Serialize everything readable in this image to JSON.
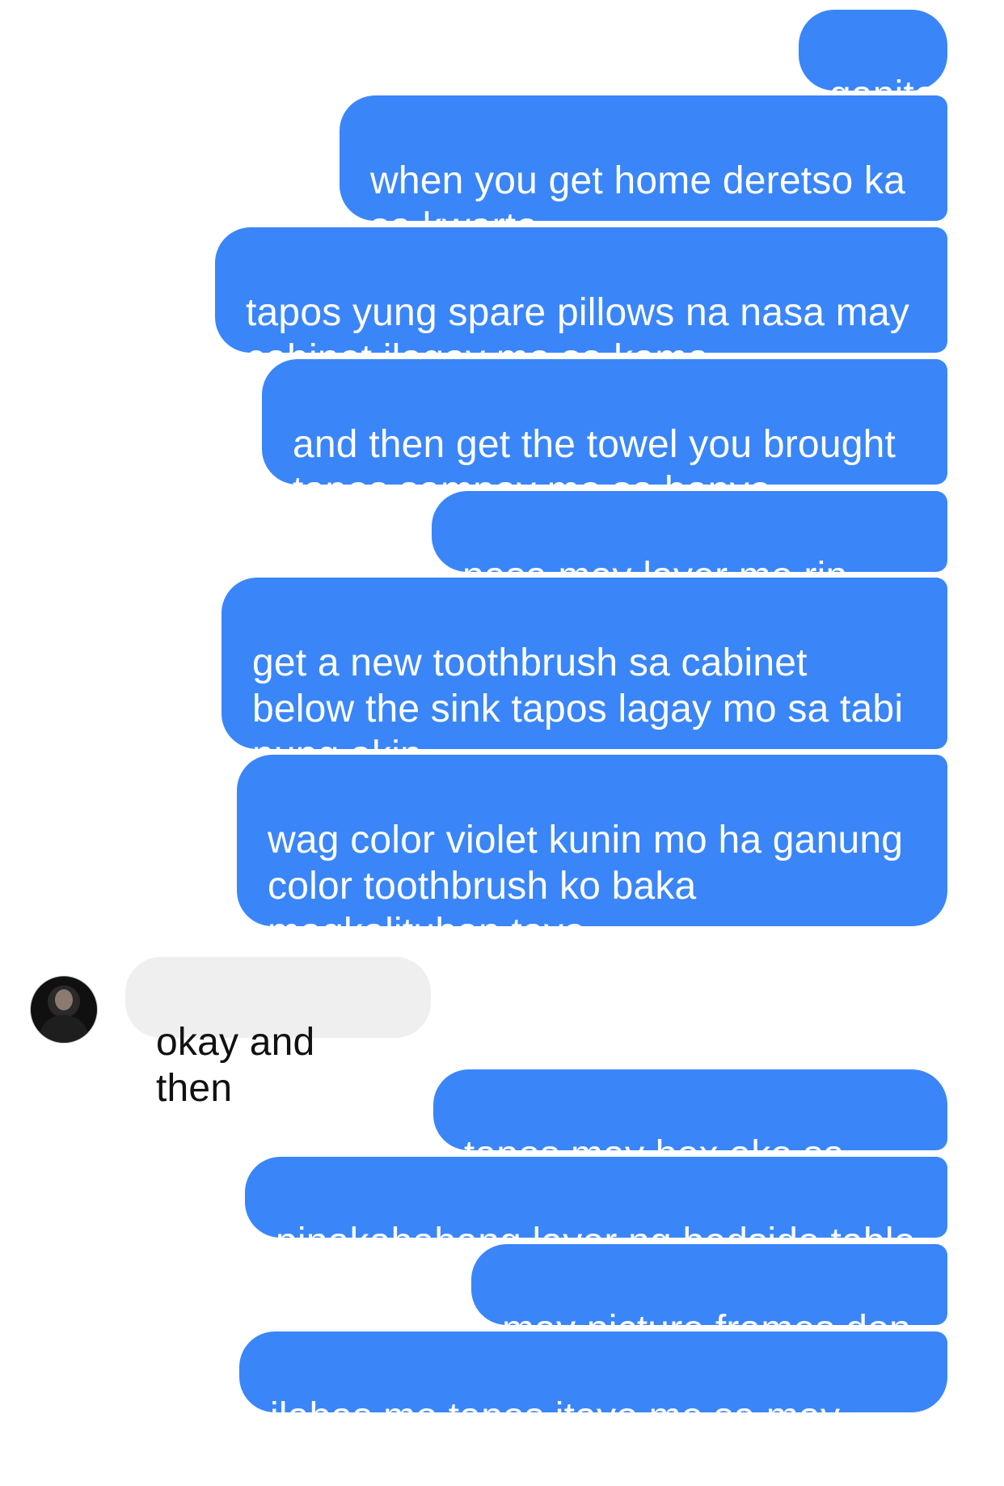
{
  "colors": {
    "outgoing_bubble": "#3a86f8",
    "incoming_bubble": "#efefef",
    "outgoing_text": "#ffffff",
    "incoming_text": "#111111"
  },
  "messages": [
    {
      "direction": "outgoing",
      "text": "ganito"
    },
    {
      "direction": "outgoing",
      "text": "when you get home deretso ka\nsa kwarto"
    },
    {
      "direction": "outgoing",
      "text": "tapos yung spare pillows na nasa may\ncabinet ilagay mo sa kama"
    },
    {
      "direction": "outgoing",
      "text": "and then get the towel you brought\ntapos sampay mo sa banyo"
    },
    {
      "direction": "outgoing",
      "text": "nasa may layer mo rin yun"
    },
    {
      "direction": "outgoing",
      "text": "get a new toothbrush sa cabinet\nbelow the sink tapos lagay mo sa tabi\nnung akin"
    },
    {
      "direction": "outgoing",
      "text": "wag color violet kunin mo ha ganung\ncolor toothbrush ko baka\nmagkalituhan tayo"
    },
    {
      "direction": "incoming",
      "text": "okay and then",
      "avatar_icon": "contact-avatar"
    },
    {
      "direction": "outgoing",
      "text": "tapos may box ako sa ano"
    },
    {
      "direction": "outgoing",
      "text": "pinakababang layer ng bedside table"
    },
    {
      "direction": "outgoing",
      "text": "may picture frames don"
    },
    {
      "direction": "outgoing",
      "text": "ilabas mo tapos itayo mo sa may sala"
    }
  ]
}
